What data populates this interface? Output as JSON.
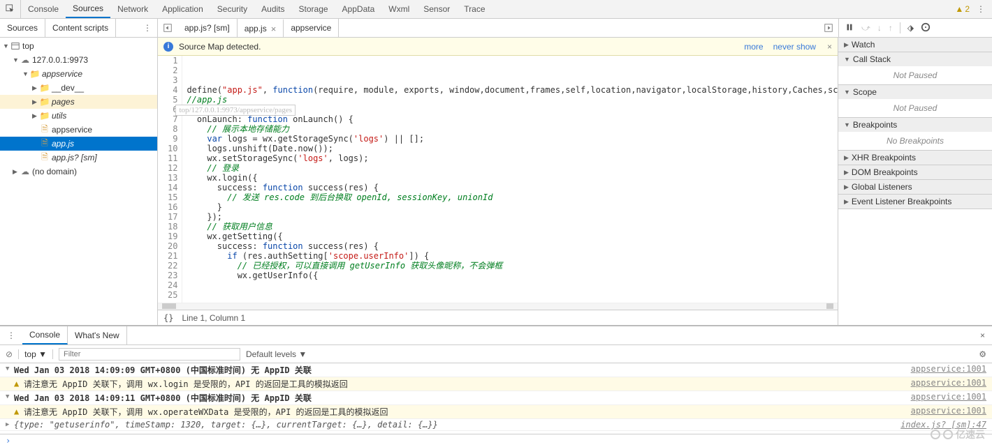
{
  "topTabs": {
    "items": [
      "Console",
      "Sources",
      "Network",
      "Application",
      "Security",
      "Audits",
      "Storage",
      "AppData",
      "Wxml",
      "Sensor",
      "Trace"
    ],
    "active": 1,
    "warnCount": "2"
  },
  "subTabs": {
    "items": [
      "Sources",
      "Content scripts"
    ],
    "active": 0
  },
  "fileTabs": {
    "items": [
      {
        "label": "app.js? [sm]",
        "active": false,
        "closeable": false
      },
      {
        "label": "app.js",
        "active": true,
        "closeable": true
      },
      {
        "label": "appservice",
        "active": false,
        "closeable": false
      }
    ]
  },
  "tree": {
    "rows": [
      {
        "indent": 4,
        "arrow": "▼",
        "icon": "window",
        "label": "top",
        "sel": false
      },
      {
        "indent": 18,
        "arrow": "▼",
        "icon": "cloud",
        "label": "127.0.0.1:9973",
        "sel": false
      },
      {
        "indent": 32,
        "arrow": "▼",
        "icon": "folder",
        "label": "appservice",
        "sel": false,
        "italic": true
      },
      {
        "indent": 46,
        "arrow": "▶",
        "icon": "folder",
        "label": "__dev__",
        "sel": false
      },
      {
        "indent": 46,
        "arrow": "▶",
        "icon": "folder",
        "label": "pages",
        "sel": false,
        "hl": true,
        "italic": true
      },
      {
        "indent": 46,
        "arrow": "▶",
        "icon": "folder",
        "label": "utils",
        "sel": false,
        "italic": true
      },
      {
        "indent": 46,
        "arrow": "",
        "icon": "file",
        "label": "appservice",
        "sel": false
      },
      {
        "indent": 46,
        "arrow": "",
        "icon": "file",
        "label": "app.js",
        "sel": true,
        "italic": true
      },
      {
        "indent": 46,
        "arrow": "",
        "icon": "file",
        "label": "app.js? [sm]",
        "sel": false,
        "italic": true
      },
      {
        "indent": 18,
        "arrow": "▶",
        "icon": "cloud",
        "label": "(no domain)",
        "sel": false
      }
    ]
  },
  "infoBar": {
    "text": "Source Map detected.",
    "more": "more",
    "never": "never show"
  },
  "code": {
    "lineStart": 1,
    "lineEnd": 25,
    "hint": "top/127.0.0.1:9973/appservice/pages"
  },
  "statusBar": {
    "braces": "{}",
    "pos": "Line 1, Column 1"
  },
  "rightPanel": {
    "sections": [
      {
        "title": "Watch",
        "open": false
      },
      {
        "title": "Call Stack",
        "open": true,
        "body": "Not Paused"
      },
      {
        "title": "Scope",
        "open": true,
        "body": "Not Paused"
      },
      {
        "title": "Breakpoints",
        "open": true,
        "body": "No Breakpoints"
      },
      {
        "title": "XHR Breakpoints",
        "open": false
      },
      {
        "title": "DOM Breakpoints",
        "open": false
      },
      {
        "title": "Global Listeners",
        "open": false
      },
      {
        "title": "Event Listener Breakpoints",
        "open": false
      }
    ]
  },
  "console": {
    "tabs": [
      "Console",
      "What's New"
    ],
    "active": 0,
    "context": "top",
    "filterPlaceholder": "Filter",
    "levels": "Default levels ▼",
    "logs": [
      {
        "type": "group",
        "msg": "Wed Jan 03 2018 14:09:09 GMT+0800 (中国标准时间) 无 AppID 关联",
        "src": "appservice:1001"
      },
      {
        "type": "warn",
        "msg": "请注意无 AppID 关联下，调用 wx.login 是受限的，API 的返回是工具的模拟返回",
        "src": "appservice:1001"
      },
      {
        "type": "group",
        "msg": "Wed Jan 03 2018 14:09:11 GMT+0800 (中国标准时间) 无 AppID 关联",
        "src": "appservice:1001"
      },
      {
        "type": "warn",
        "msg": "请注意无 AppID 关联下，调用 wx.operateWXData 是受限的，API 的返回是工具的模拟返回",
        "src": "appservice:1001"
      },
      {
        "type": "obj",
        "msg": "{type: \"getuserinfo\", timeStamp: 1320, target: {…}, currentTarget: {…}, detail: {…}}",
        "src": "index.js? [sm]:47"
      }
    ]
  },
  "watermark": "亿速云"
}
